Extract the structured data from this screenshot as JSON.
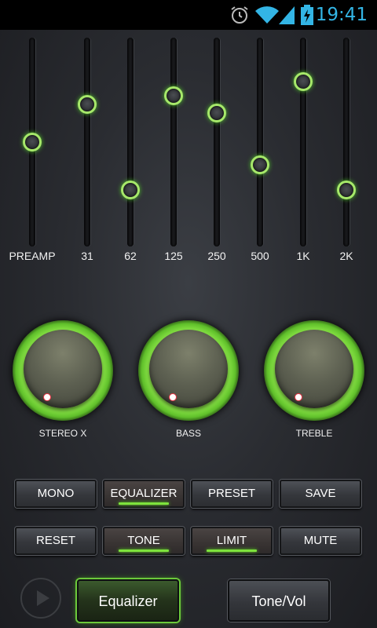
{
  "statusbar": {
    "time": "19:41",
    "icons": [
      "alarm-icon",
      "wifi-icon",
      "signal-icon",
      "battery-charging-icon"
    ],
    "accent_color": "#33b5e5"
  },
  "equalizer": {
    "bands": [
      {
        "label": "PREAMP",
        "level": 0.5
      },
      {
        "label": "31",
        "level": 0.68
      },
      {
        "label": "62",
        "level": 0.27
      },
      {
        "label": "125",
        "level": 0.72
      },
      {
        "label": "250",
        "level": 0.64
      },
      {
        "label": "500",
        "level": 0.39
      },
      {
        "label": "1K",
        "level": 0.79
      },
      {
        "label": "2K",
        "level": 0.27
      }
    ],
    "accent_color": "#a6e86a"
  },
  "knobs": [
    {
      "label": "STEREO X"
    },
    {
      "label": "BASS"
    },
    {
      "label": "TREBLE"
    }
  ],
  "buttons": {
    "row1": [
      {
        "label": "MONO",
        "active": false
      },
      {
        "label": "EQUALIZER",
        "active": true
      },
      {
        "label": "PRESET",
        "active": false
      },
      {
        "label": "SAVE",
        "active": false
      }
    ],
    "row2": [
      {
        "label": "RESET",
        "active": false
      },
      {
        "label": "TONE",
        "active": true
      },
      {
        "label": "LIMIT",
        "active": true
      },
      {
        "label": "MUTE",
        "active": false
      }
    ]
  },
  "tabs": {
    "equalizer": "Equalizer",
    "tone_vol": "Tone/Vol",
    "selected": "Equalizer"
  }
}
